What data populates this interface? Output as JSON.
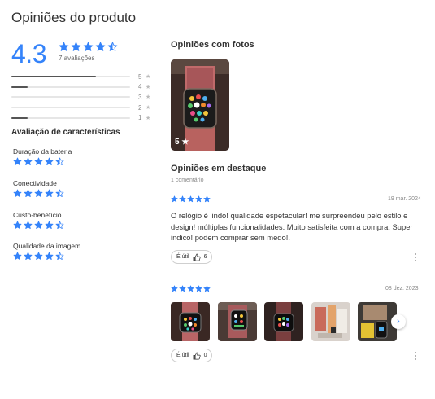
{
  "title": "Opiniões do produto",
  "summary": {
    "average": "4.3",
    "count_label": "7 avaliações",
    "rating": 4.5
  },
  "distribution": [
    {
      "stars": "5",
      "fraction": 0.71
    },
    {
      "stars": "4",
      "fraction": 0.14
    },
    {
      "stars": "3",
      "fraction": 0.0
    },
    {
      "stars": "2",
      "fraction": 0.0
    },
    {
      "stars": "1",
      "fraction": 0.14
    }
  ],
  "characteristics": {
    "title": "Avaliação de características",
    "items": [
      {
        "label": "Duração da bateria",
        "rating": 4.5
      },
      {
        "label": "Conectividade",
        "rating": 4.5
      },
      {
        "label": "Custo-benefício",
        "rating": 4.5
      },
      {
        "label": "Qualidade da imagem",
        "rating": 4.5
      }
    ]
  },
  "photos": {
    "title": "Opiniões com fotos",
    "main_count": "5"
  },
  "featured": {
    "title": "Opiniões em destaque",
    "count": "1 comentário"
  },
  "reviews": [
    {
      "rating": 5,
      "date": "19 mar. 2024",
      "text": "O relógio é lindo! qualidade espetacular! me surpreendeu pelo estilo e design! múltiplas funcionalidades. Muito satisfeita com a compra. Super indico! podem comprar sem medo!.",
      "useful_label": "É útil",
      "useful_count": "6"
    },
    {
      "rating": 5,
      "date": "08 dez. 2023",
      "useful_label": "É útil",
      "useful_count": "0"
    }
  ],
  "icons": {
    "star": "star-icon",
    "thumb": "thumbs-up-icon",
    "more": "kebab-menu-icon",
    "next": "chevron-right-icon"
  },
  "colors": {
    "accent": "#3483fa",
    "bar_fill": "#555555",
    "bar_track": "#e6e6e6"
  }
}
